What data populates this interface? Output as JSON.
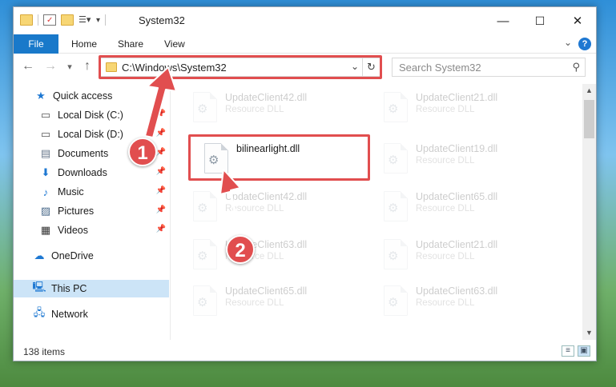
{
  "window": {
    "title": "System32",
    "controls": {
      "minimize": "—",
      "maximize": "☐",
      "close": "✕"
    }
  },
  "ribbon": {
    "tabs": [
      "File",
      "Home",
      "Share",
      "View"
    ],
    "help": "?"
  },
  "navbar": {
    "back": "←",
    "forward": "→",
    "recent": "▾",
    "up": "↑",
    "address": "C:\\Windows\\System32",
    "search_placeholder": "Search System32"
  },
  "sidebar": {
    "items": [
      {
        "label": "Quick access",
        "icon": "star-icon"
      },
      {
        "label": "Local Disk (C:)",
        "icon": "drive-icon",
        "pinned": true
      },
      {
        "label": "Local Disk (D:)",
        "icon": "drive-icon",
        "pinned": true
      },
      {
        "label": "Documents",
        "icon": "documents-icon",
        "pinned": true
      },
      {
        "label": "Downloads",
        "icon": "download-icon",
        "pinned": true
      },
      {
        "label": "Music",
        "icon": "music-icon",
        "pinned": true
      },
      {
        "label": "Pictures",
        "icon": "pictures-icon",
        "pinned": true
      },
      {
        "label": "Videos",
        "icon": "video-icon",
        "pinned": true
      },
      {
        "label": "OneDrive",
        "icon": "cloud-icon"
      },
      {
        "label": "This PC",
        "icon": "computer-icon",
        "selected": true
      },
      {
        "label": "Network",
        "icon": "network-icon"
      }
    ]
  },
  "files": [
    {
      "name": "UpdateClient42.dll",
      "desc": "Resource DLL",
      "faded": true
    },
    {
      "name": "UpdateClient21.dll",
      "desc": "Resource DLL",
      "faded": true
    },
    {
      "name": "bilinearlight.dll",
      "desc": "",
      "faded": false
    },
    {
      "name": "UpdateClient19.dll",
      "desc": "Resource DLL",
      "faded": true
    },
    {
      "name": "UpdateClient42.dll",
      "desc": "Resource DLL",
      "faded": true
    },
    {
      "name": "UpdateClient65.dll",
      "desc": "Resource DLL",
      "faded": true
    },
    {
      "name": "UpdateClient63.dll",
      "desc": "Resource DLL",
      "faded": true
    },
    {
      "name": "UpdateClient21.dll",
      "desc": "Resource DLL",
      "faded": true
    },
    {
      "name": "UpdateClient65.dll",
      "desc": "Resource DLL",
      "faded": true
    },
    {
      "name": "UpdateClient63.dll",
      "desc": "Resource DLL",
      "faded": true
    }
  ],
  "status": {
    "items": "138 items"
  },
  "callouts": [
    "1",
    "2"
  ],
  "colors": {
    "accent": "#1979ca",
    "annotation": "#e14e4f",
    "selected": "#cce4f7"
  }
}
